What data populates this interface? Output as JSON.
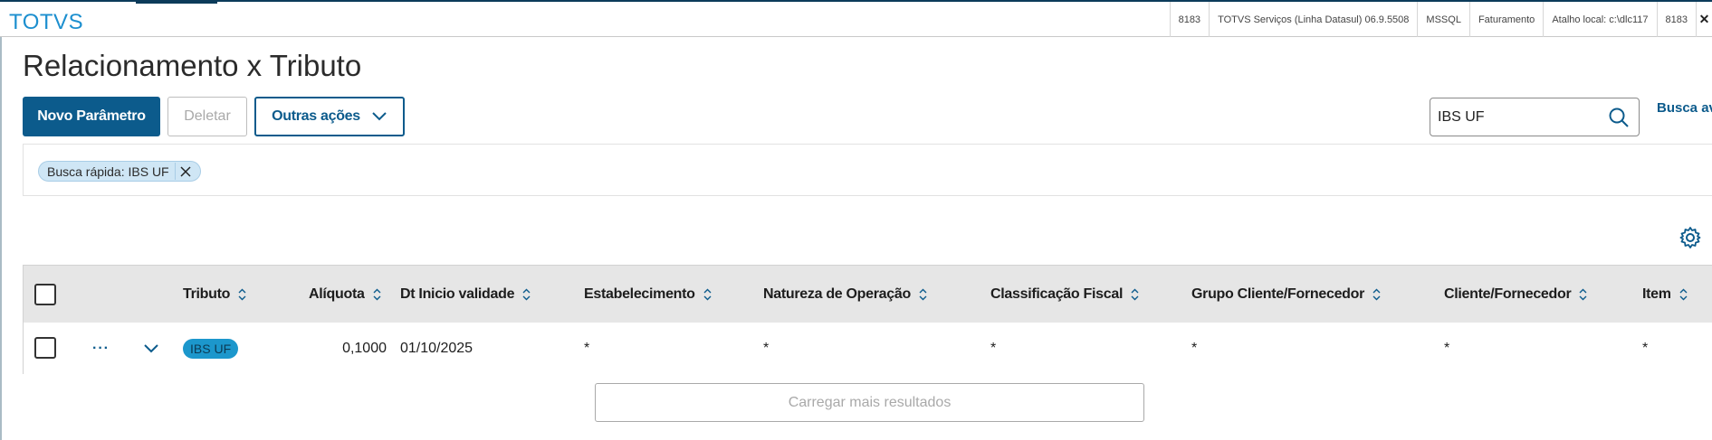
{
  "app": {
    "logo": "TOTVS",
    "status": [
      "8183",
      "TOTVS Serviços (Linha Datasul) 06.9.5508",
      "MSSQL",
      "Faturamento",
      "Atalho local: c:\\dlc117",
      "8183"
    ],
    "close_label": "✕"
  },
  "page": {
    "title": "Relacionamento x Tributo"
  },
  "toolbar": {
    "new_label": "Novo Parâmetro",
    "delete_label": "Deletar",
    "more_label": "Outras ações"
  },
  "search": {
    "value": "IBS UF",
    "advanced_label": "Busca avançada"
  },
  "filters": {
    "chip_label": "Busca rápida: IBS UF"
  },
  "table": {
    "columns": {
      "tributo": "Tributo",
      "aliquota": "Alíquota",
      "dt_inicio": "Dt Inicio validade",
      "estabelecimento": "Estabelecimento",
      "natureza": "Natureza de Operação",
      "classificacao": "Classificação Fiscal",
      "grupo": "Grupo Cliente/Fornecedor",
      "cliente": "Cliente/Fornecedor",
      "item": "Item"
    },
    "rows": [
      {
        "actions": "···",
        "tributo": "IBS UF",
        "aliquota": "0,1000",
        "dt_inicio": "01/10/2025",
        "estabelecimento": "*",
        "natureza": "*",
        "classificacao": "*",
        "grupo": "*",
        "cliente": "*",
        "item": "*"
      }
    ]
  },
  "load_more_label": "Carregar mais resultados",
  "colors": {
    "primary": "#0c5b8c",
    "logo": "#1c8fcf",
    "tag": "#1c97cc",
    "header_bg": "#e6e6e6"
  }
}
